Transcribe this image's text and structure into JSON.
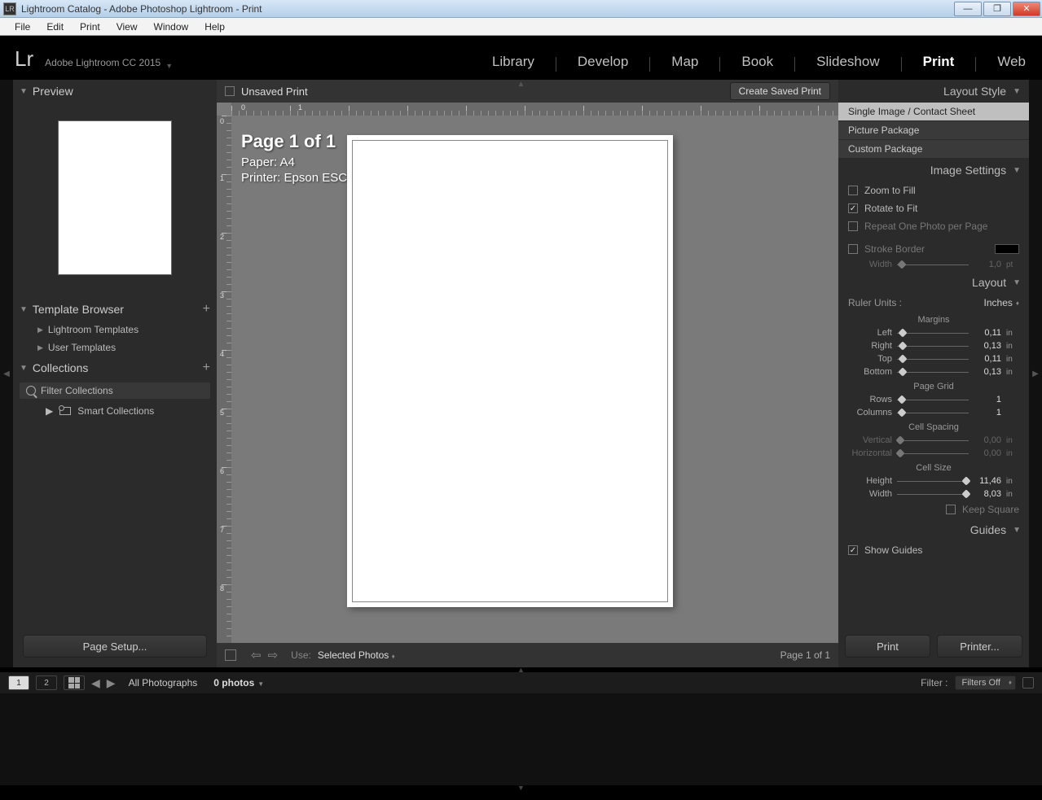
{
  "window": {
    "title": "Lightroom Catalog - Adobe Photoshop Lightroom - Print",
    "app_abbrev": "LR"
  },
  "menubar": [
    "File",
    "Edit",
    "Print",
    "View",
    "Window",
    "Help"
  ],
  "brand": {
    "logo": "Lr",
    "name": "Adobe Lightroom CC 2015"
  },
  "modules": [
    "Library",
    "Develop",
    "Map",
    "Book",
    "Slideshow",
    "Print",
    "Web"
  ],
  "active_module": "Print",
  "left": {
    "preview_title": "Preview",
    "template_browser_title": "Template Browser",
    "templates": [
      "Lightroom Templates",
      "User Templates"
    ],
    "collections_title": "Collections",
    "filter_placeholder": "Filter Collections",
    "smart_collections": "Smart Collections",
    "page_setup_btn": "Page Setup..."
  },
  "center": {
    "doc_name": "Unsaved Print",
    "save_btn": "Create Saved Print",
    "overlay_page": "Page 1 of 1",
    "overlay_paper": "Paper:  A4",
    "overlay_printer": "Printer:  Epson ESC/P-R",
    "use_label": "Use:",
    "use_value": "Selected Photos",
    "page_status": "Page 1 of 1"
  },
  "right": {
    "layout_style_title": "Layout Style",
    "layout_styles": [
      "Single Image / Contact Sheet",
      "Picture Package",
      "Custom Package"
    ],
    "image_settings_title": "Image Settings",
    "zoom_to_fill": "Zoom to Fill",
    "rotate_to_fit": "Rotate to Fit",
    "repeat_one": "Repeat One Photo per Page",
    "stroke_border": "Stroke Border",
    "stroke_width_label": "Width",
    "stroke_width_value": "1,0",
    "stroke_width_unit": "pt",
    "layout_title": "Layout",
    "ruler_units_label": "Ruler Units :",
    "ruler_units_value": "Inches",
    "margins_label": "Margins",
    "margins": {
      "left_label": "Left",
      "left_val": "0,11",
      "right_label": "Right",
      "right_val": "0,13",
      "top_label": "Top",
      "top_val": "0,11",
      "bottom_label": "Bottom",
      "bottom_val": "0,13"
    },
    "page_grid_label": "Page Grid",
    "rows_label": "Rows",
    "rows_val": "1",
    "cols_label": "Columns",
    "cols_val": "1",
    "cell_spacing_label": "Cell Spacing",
    "vspace_label": "Vertical",
    "vspace_val": "0,00",
    "hspace_label": "Horizontal",
    "hspace_val": "0,00",
    "cell_size_label": "Cell Size",
    "height_label": "Height",
    "height_val": "11,46",
    "width_label": "Width",
    "width_val": "8,03",
    "keep_square": "Keep Square",
    "unit_in": "in",
    "guides_title": "Guides",
    "show_guides": "Show Guides",
    "print_btn": "Print",
    "printer_btn": "Printer..."
  },
  "filmstrip": {
    "view_1": "1",
    "view_2": "2",
    "path": "All Photographs",
    "count": "0 photos",
    "filter_label": "Filter :",
    "filter_value": "Filters Off"
  }
}
